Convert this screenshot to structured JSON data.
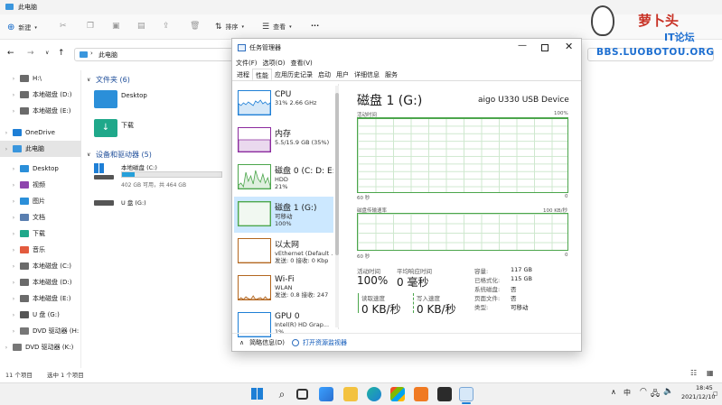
{
  "explorer": {
    "title": "此电脑",
    "toolbar": {
      "new_label": "新建",
      "sort_label": "排序",
      "view_label": "查看",
      "more_label": "···"
    },
    "address": "此电脑",
    "nav": [
      {
        "label": "H:\\",
        "icon": "drive-icon",
        "indent": 1
      },
      {
        "label": "本地磁盘 (D:)",
        "icon": "drive-icon",
        "indent": 1
      },
      {
        "label": "本地磁盘 (E:)",
        "icon": "drive-icon",
        "indent": 1
      },
      {
        "label": "OneDrive",
        "icon": "cloud-icon",
        "indent": 0
      },
      {
        "label": "此电脑",
        "icon": "pc-icon",
        "indent": 0,
        "selected": true
      },
      {
        "label": "Desktop",
        "icon": "desktop-icon",
        "indent": 1
      },
      {
        "label": "视频",
        "icon": "video-icon",
        "indent": 1
      },
      {
        "label": "图片",
        "icon": "picture-icon",
        "indent": 1
      },
      {
        "label": "文档",
        "icon": "document-icon",
        "indent": 1
      },
      {
        "label": "下载",
        "icon": "download-icon",
        "indent": 1
      },
      {
        "label": "音乐",
        "icon": "music-icon",
        "indent": 1
      },
      {
        "label": "本地磁盘 (C:)",
        "icon": "drive-icon",
        "indent": 1
      },
      {
        "label": "本地磁盘 (D:)",
        "icon": "drive-icon",
        "indent": 1
      },
      {
        "label": "本地磁盘 (E:)",
        "icon": "drive-icon",
        "indent": 1
      },
      {
        "label": "U 盘 (G:)",
        "icon": "usb-icon",
        "indent": 1
      },
      {
        "label": "DVD 驱动器 (H:",
        "icon": "dvd-icon",
        "indent": 1
      },
      {
        "label": "DVD 驱动器 (K:)",
        "icon": "dvd-icon",
        "indent": 0
      }
    ],
    "folders_header": "文件夹 (6)",
    "folders": [
      "Desktop",
      "下载"
    ],
    "devices_header": "设备和驱动器 (5)",
    "drives": [
      {
        "name": "本地磁盘 (C:)",
        "detail": "402 GB 可用，共 464 GB",
        "used_fraction": 0.13
      },
      {
        "name": "U 盘 (G:)",
        "detail": ""
      }
    ],
    "status_left": "11 个项目",
    "status_sel": "选中 1 个项目"
  },
  "watermark": {
    "title": "萝卜头",
    "subtitle": "IT论坛",
    "url": "BBS.LUOBOTOU.ORG"
  },
  "taskmgr": {
    "title": "任务管理器",
    "menu": [
      "文件(F)",
      "选项(O)",
      "查看(V)"
    ],
    "tabs": [
      "进程",
      "性能",
      "应用历史记录",
      "启动",
      "用户",
      "详细信息",
      "服务"
    ],
    "active_tab": 1,
    "tiles": [
      {
        "name": "CPU",
        "l2": "31% 2.66 GHz",
        "l3": "",
        "color": "#1e7fd6"
      },
      {
        "name": "内存",
        "l2": "5.5/15.9 GB (35%)",
        "l3": "",
        "color": "#8b2a9e"
      },
      {
        "name": "磁盘 0 (C: D: E:",
        "l2": "HDD",
        "l3": "21%",
        "color": "#4ca64c"
      },
      {
        "name": "磁盘 1 (G:)",
        "l2": "可移动",
        "l3": "100%",
        "color": "#4ca64c",
        "selected": true
      },
      {
        "name": "以太网",
        "l2": "vEthernet (Default .",
        "l3": "发送: 0 接收: 0 Kbp",
        "color": "#b3661f"
      },
      {
        "name": "Wi-Fi",
        "l2": "WLAN",
        "l3": "发送: 0.8 接收: 247",
        "color": "#b3661f"
      },
      {
        "name": "GPU 0",
        "l2": "Intel(R) HD Grap...",
        "l3": "1%",
        "color": "#1e7fd6"
      }
    ],
    "main": {
      "heading": "磁盘 1 (G:)",
      "device": "aigo U330 USB Device",
      "g1_label": "活动时间",
      "g1_max": "100%",
      "g1_min": "0",
      "g1_time": "60 秒",
      "g2_label": "磁盘传输速率",
      "g2_max": "100 KB/秒",
      "g2_min": "0",
      "g2_time": "60 秒",
      "active_time_label": "活动时间",
      "active_time": "100%",
      "avg_resp_label": "平均响应时间",
      "avg_resp": "0 毫秒",
      "read_label": "读取速度",
      "read": "0 KB/秒",
      "write_label": "写入速度",
      "write": "0 KB/秒",
      "props": [
        {
          "k": "容量:",
          "v": "117 GB"
        },
        {
          "k": "已格式化:",
          "v": "115 GB"
        },
        {
          "k": "系统磁盘:",
          "v": "否"
        },
        {
          "k": "页面文件:",
          "v": "否"
        },
        {
          "k": "类型:",
          "v": "可移动"
        }
      ]
    },
    "footer_brief": "简略信息(D)",
    "footer_monitor": "打开资源监视器"
  },
  "taskbar": {
    "lang": "中",
    "time": "18:45",
    "date": "2021/12/10"
  }
}
